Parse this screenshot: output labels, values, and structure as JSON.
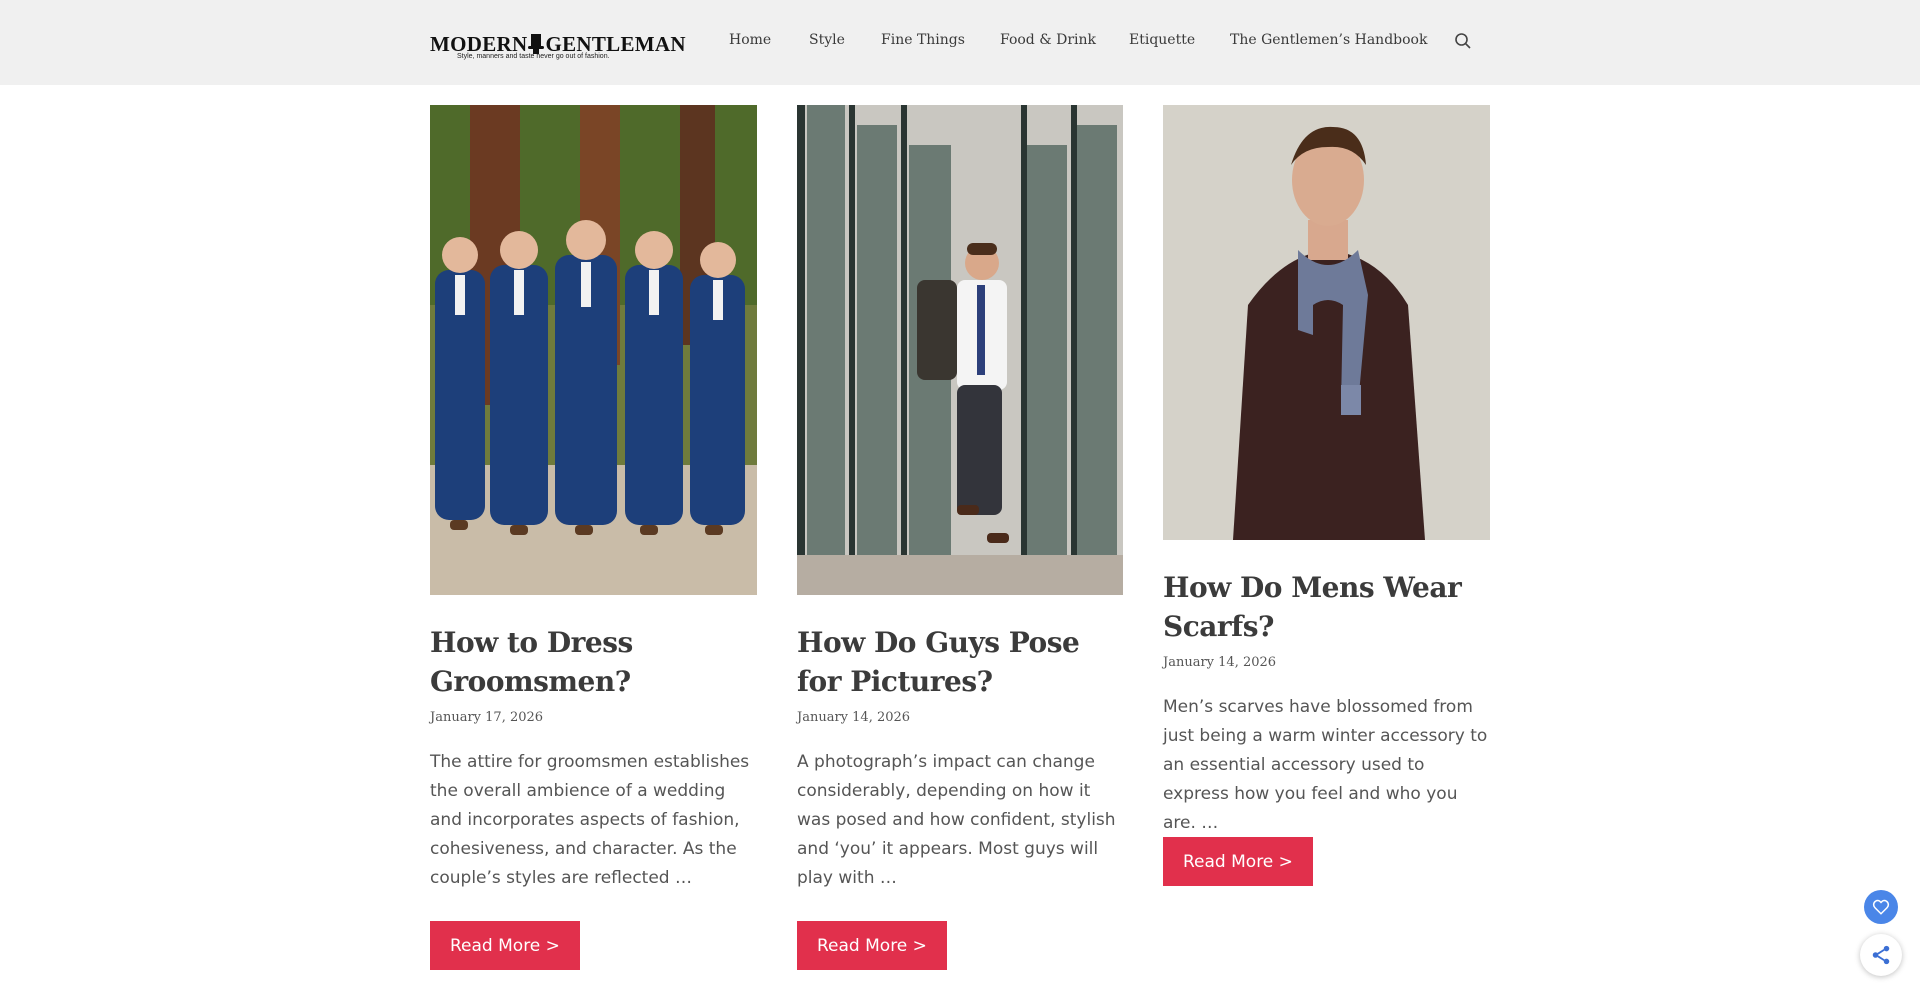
{
  "header": {
    "logo_text_left": "MODERN",
    "logo_text_right": "GENTLEMAN",
    "logo_tagline": "Style, manners and taste never go out of fashion.",
    "nav": [
      "Home",
      "Style",
      "Fine Things",
      "Food & Drink",
      "Etiquette",
      "The Gentlemen’s Handbook"
    ],
    "search_icon": "search-icon"
  },
  "posts": [
    {
      "title": "How to Dress Groomsmen?",
      "date": "January 17, 2026",
      "excerpt": "The attire for groomsmen establishes the overall ambience of a wedding and incorporates aspects of fashion, cohesiveness, and character. As the couple’s styles are reflected …",
      "button": "Read More >",
      "image": "groomsmen-in-blue-suits-photo"
    },
    {
      "title": "How Do Guys Pose for Pictures?",
      "date": "January 14, 2026",
      "excerpt": "A photograph’s impact can change considerably, depending on how it was posed and how confident, stylish and ‘you’ it appears. Most guys will play with …",
      "button": "Read More >",
      "image": "man-leaning-on-glass-wall-photo"
    },
    {
      "title": "How Do Mens Wear Scarfs?",
      "date": "January 14, 2026",
      "excerpt": "Men’s scarves have blossomed from just being a warm winter accessory to an essential accessory used to express how you feel and who you are. …",
      "button": "Read More >",
      "image": "man-in-coat-and-scarf-photo"
    }
  ],
  "floating": {
    "favorite_icon": "heart-icon",
    "share_icon": "share-icon"
  },
  "colors": {
    "accent": "#e1304c",
    "header_bg": "#f0f0f0",
    "fab_blue": "#4a86e8"
  }
}
